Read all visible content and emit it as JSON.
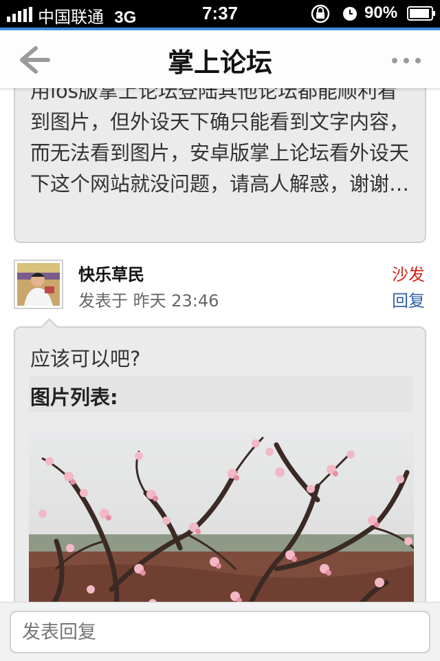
{
  "status_bar": {
    "carrier": "中国联通",
    "network": "3G",
    "time": "7:37",
    "battery": "90%",
    "icons": [
      "signal-icon",
      "orientation-lock-icon",
      "alarm-clock-icon",
      "battery-icon"
    ]
  },
  "nav": {
    "title": "掌上论坛",
    "back_icon": "back-arrow-icon",
    "more_icon": "more-dots-icon",
    "accent_color": "#3a8ed8"
  },
  "original_post": {
    "text": "用ios版掌上论坛登陆其他论坛都能顺利看到图片，但外设天下确只能看到文字内容，而无法看到图片，安卓版掌上论坛看外设天下这个网站就没问题，请高人解惑，谢谢…"
  },
  "reply": {
    "username": "快乐草民",
    "meta": "发表于 昨天 23:46",
    "floor_label": "沙发",
    "reply_link": "回复",
    "text": "应该可以吧?",
    "image_list_label": "图片列表:",
    "floor_color": "#d8231a",
    "link_color": "#2b5fa3"
  },
  "reply_bar": {
    "placeholder": "发表回复"
  }
}
